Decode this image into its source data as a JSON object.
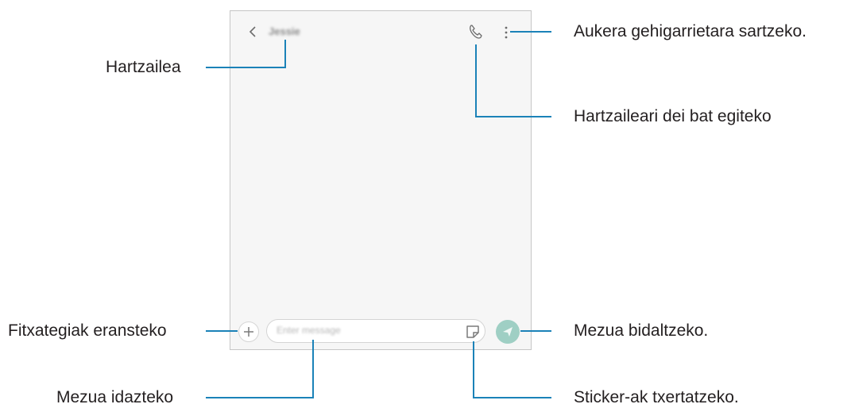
{
  "callouts": {
    "more_options": "Aukera gehigarrietara sartzeko.",
    "recipient": "Hartzailea",
    "call_recipient": "Hartzaileari dei bat egiteko",
    "attach_files": "Fitxategiak eransteko",
    "send_message": "Mezua bidaltzeko.",
    "write_message": "Mezua idazteko",
    "insert_stickers": "Sticker-ak txertatzeko."
  },
  "phone": {
    "contact_name": "Jessie",
    "message_placeholder": "Enter message"
  },
  "icons": [
    "back-icon",
    "phone-call-icon",
    "more-options-icon",
    "add-icon",
    "sticker-icon",
    "send-icon"
  ],
  "colors": {
    "leader_line": "#1b82b8",
    "screen_background": "#f6f6f6",
    "send_button": "#9fcfc4"
  }
}
